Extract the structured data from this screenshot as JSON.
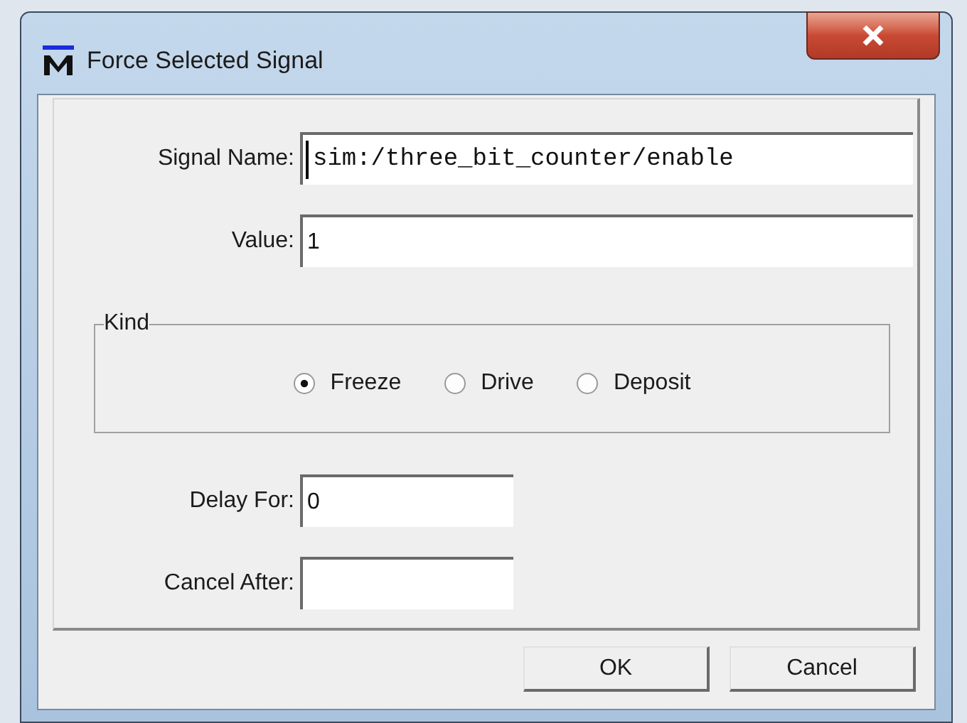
{
  "window": {
    "title": "Force Selected Signal"
  },
  "fields": [
    {
      "label": "Signal Name:",
      "value": "sim:/three_bit_counter/enable",
      "kind": "path",
      "focused": true
    },
    {
      "label": "Value:",
      "value": "1",
      "kind": "text",
      "focused": false
    }
  ],
  "kind_group": {
    "title": "Kind",
    "options": [
      {
        "label": "Freeze",
        "selected": true
      },
      {
        "label": "Drive",
        "selected": false
      },
      {
        "label": "Deposit",
        "selected": false
      }
    ]
  },
  "timing_fields": [
    {
      "label": "Delay For:",
      "value": "0"
    },
    {
      "label": "Cancel After:"
    }
  ],
  "buttons": [
    "OK",
    "Cancel"
  ]
}
